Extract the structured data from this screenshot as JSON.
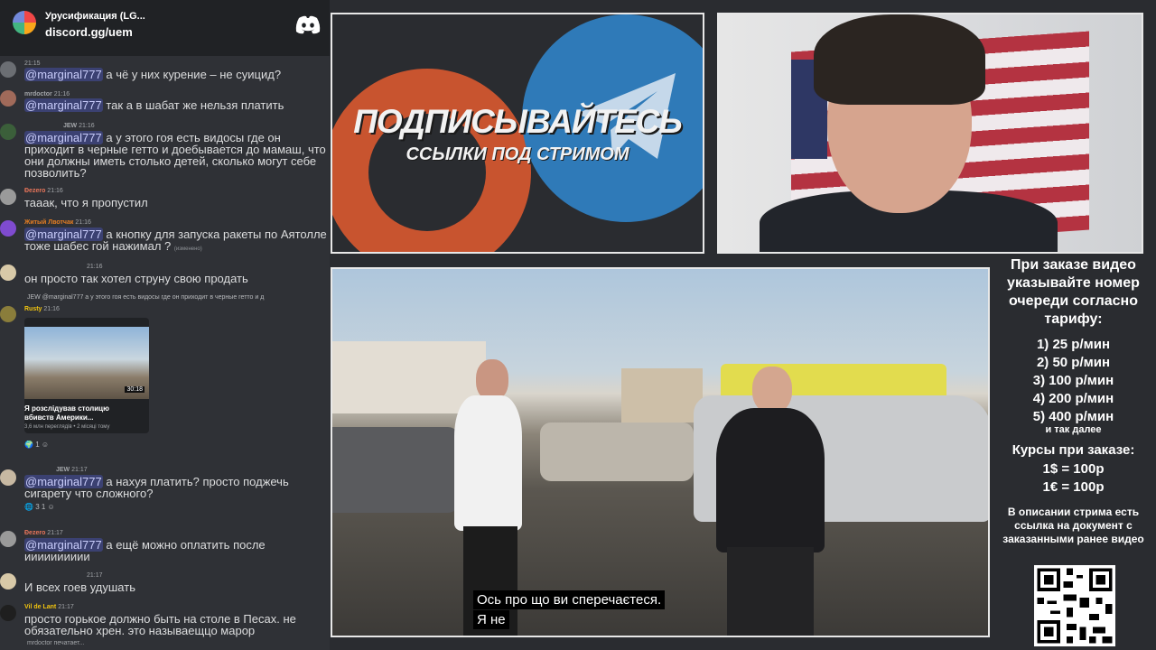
{
  "server": {
    "name": "Урусификация (LG...",
    "invite": "discord.gg/uem",
    "logo_icon": "discord-logo-icon"
  },
  "chat": [
    {
      "meta": "21:15",
      "mention": "@marginal777",
      "text": " а чё у них курение – не суицид?"
    },
    {
      "user": "mrdoctor",
      "meta": "21:16",
      "mention": "@marginal777",
      "text": " так а в шабат же нельзя платить"
    },
    {
      "user": "JEW",
      "meta": "21:16",
      "mention": "@marginal777",
      "text": " а у этого гоя есть видосы где он приходит в черные гетто и доебывается до мамаш, что они должны иметь столько детей, сколько могут себе позволить?"
    },
    {
      "user": "Ðezero",
      "meta": "21:16",
      "text": "тааак, что я пропустил"
    },
    {
      "user": "Житый Лвотчак",
      "meta": "21:16",
      "mention": "@marginal777",
      "text": " а кнопку для запуска ракеты по Аятолле тоже шабес гой нажимал ?",
      "edited": "(изменено)"
    },
    {
      "meta": "21:16",
      "text": "он просто так хотел струну свою продать"
    },
    {
      "user": "Rusty",
      "meta": "21:16",
      "reply": "JEW @marginal777 а у этого гоя есть видосы где он приходит в черные гетто и д",
      "embed": {
        "title": "Я розслідував столицю вбивств Америки...",
        "sub": "3,6 млн переглядів • 2 місяці тому",
        "duration": "30:18"
      },
      "reactions": "1"
    },
    {
      "user": "JEW",
      "meta": "21:17",
      "mention": "@marginal777",
      "text": " а нахуя платить? просто поджечь сигарету что сложного?",
      "reactions": "3   1"
    },
    {
      "user": "Ðezero",
      "meta": "21:17",
      "mention": "@marginal777",
      "text": " а ещё можно оплатить после ииииииииии"
    },
    {
      "meta": "21:17",
      "text": "И всех гоев удушать"
    },
    {
      "user": "Vil de Lant",
      "meta": "21:17",
      "text": "просто горькое должно быть на столе в Песах. не обязательно хрен. это называещцо марор"
    }
  ],
  "typing": "mrdoctor печатает...",
  "banner": {
    "title": "ПОДПИСЫВАЙТЕСЬ",
    "subtitle": "ССЫЛКИ ПОД СТРИМОМ"
  },
  "video": {
    "subtitle_line1": "Ось про що ви сперечаєтеся.",
    "subtitle_line2": "Я не"
  },
  "info": {
    "head": "При заказе видео указывайте номер очереди согласно тарифу:",
    "tariffs": [
      "1) 25 р/мин",
      "2) 50 р/мин",
      "3) 100 р/мин",
      "4) 200 р/мин",
      "5) 400 р/мин"
    ],
    "tariff_more": "и так далее",
    "rates_title": "Курсы при заказе:",
    "rates": [
      "1$ = 100р",
      "1€ = 100р"
    ],
    "foot": "В описании стрима есть ссылка на документ с заказанными ранее видео"
  },
  "colors": {
    "chat_bg": "#2f3136",
    "header_bg": "#202225",
    "mention": "#c9cdfb",
    "patreon": "#c8542f",
    "telegram": "#2f7ab8"
  }
}
